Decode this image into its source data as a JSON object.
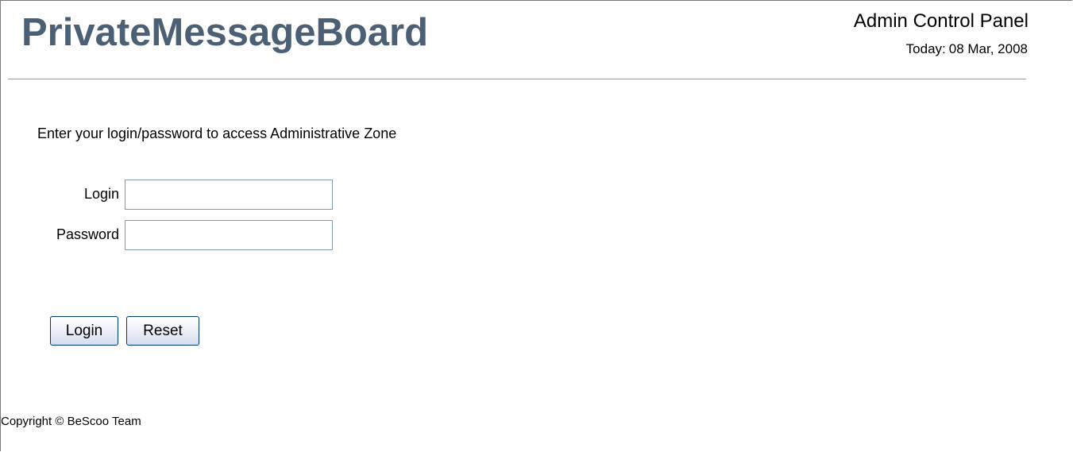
{
  "header": {
    "logo_text": "PrivateMessageBoard",
    "panel_title": "Admin Control Panel",
    "today_label": "Today:",
    "today_date": "08 Mar, 2008"
  },
  "login_form": {
    "intro_text": "Enter your login/password to access Administrative Zone",
    "login_label": "Login",
    "login_value": "",
    "password_label": "Password",
    "password_value": "",
    "login_button_label": "Login",
    "reset_button_label": "Reset"
  },
  "footer": {
    "copyright_text": "Copyright © BeScoo Team"
  },
  "colors": {
    "logo": "#4b6075",
    "input_border": "#7f9db9",
    "button_border": "#003c74"
  }
}
